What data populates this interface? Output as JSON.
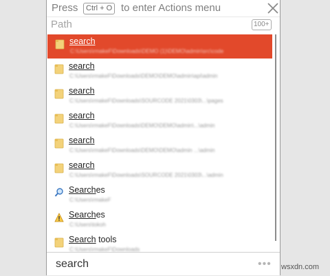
{
  "actions_bar": {
    "press": "Press",
    "shortcut": "Ctrl + O",
    "rest": "to enter Actions menu",
    "close_icon": "close-icon"
  },
  "path_bar": {
    "label": "Path",
    "count": "100+"
  },
  "results": [
    {
      "name_prefix": "",
      "name_match": "search",
      "name_suffix": "",
      "path": "C:\\Users\\rmakeF\\Downloads\\DEMO (1)\\DEMO\\admin\\src\\code",
      "icon": "folder-icon",
      "selected": true
    },
    {
      "name_prefix": "",
      "name_match": "search",
      "name_suffix": "",
      "path": "C:\\Users\\rmakeF\\Downloads\\DEMO\\DEMO\\admin\\api\\admin",
      "icon": "folder-icon"
    },
    {
      "name_prefix": "",
      "name_match": "search",
      "name_suffix": "",
      "path": "C:\\Users\\rmakeF\\Downloads\\SOURCODE 2021\\0303\\...\\pages",
      "icon": "folder-icon"
    },
    {
      "name_prefix": "",
      "name_match": "search",
      "name_suffix": "",
      "path": "C:\\Users\\rmakeF\\Downloads\\DEMO\\DEMO\\admin\\...\\admin",
      "icon": "folder-icon"
    },
    {
      "name_prefix": "",
      "name_match": "search",
      "name_suffix": "",
      "path": "C:\\Users\\rmakeF\\Downloads\\DEMO\\DEMO\\admin ...\\admin",
      "icon": "folder-icon"
    },
    {
      "name_prefix": "",
      "name_match": "search",
      "name_suffix": "",
      "path": "C:\\Users\\rmakeF\\Downloads\\SOURCODE 2021\\0303\\...\\admin",
      "icon": "folder-icon"
    },
    {
      "name_prefix": "",
      "name_match": "Search",
      "name_suffix": "es",
      "path": "C:\\Users\\rmakeF",
      "icon": "magnifier-icon"
    },
    {
      "name_prefix": "",
      "name_match": "Search",
      "name_suffix": "es",
      "path": "C:\\Users\\tokoh",
      "icon": "warning-icon"
    },
    {
      "name_prefix": "",
      "name_match": "Search",
      "name_suffix": " tools",
      "path": "C:\\Users\\rmakeF\\Downloads",
      "icon": "folder-icon"
    }
  ],
  "search": {
    "query": "search",
    "more": "•••"
  },
  "watermark": "wsxdn.com",
  "colors": {
    "selection": "#e2492b",
    "folder": "#f3d27a"
  }
}
